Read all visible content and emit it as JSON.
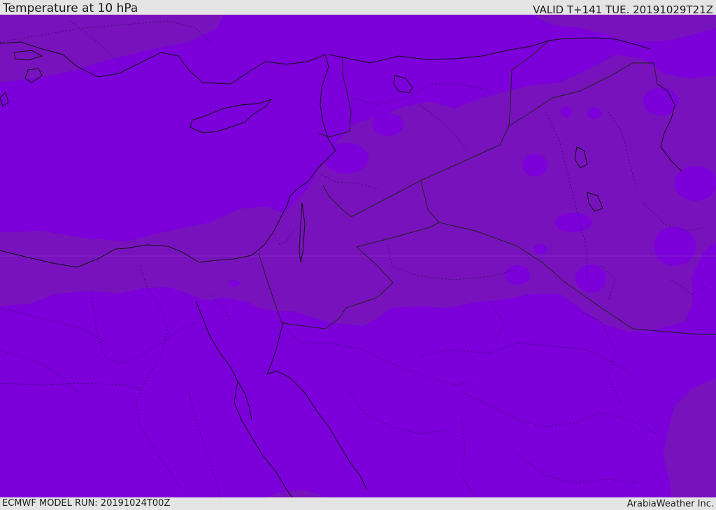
{
  "header": {
    "title": "Temperature at 10 hPa",
    "valid_time": "VALID T+141 TUE. 20191029T21Z"
  },
  "footer": {
    "model_run": "ECMWF MODEL RUN: 20191024T00Z",
    "credit": "ArabiaWeather Inc."
  },
  "map": {
    "field_colors": {
      "base_fill": "#7b00da",
      "warmer_band_fill": "#7812bd",
      "coastline_stroke": "#111111",
      "border_stroke": "#222222"
    }
  }
}
